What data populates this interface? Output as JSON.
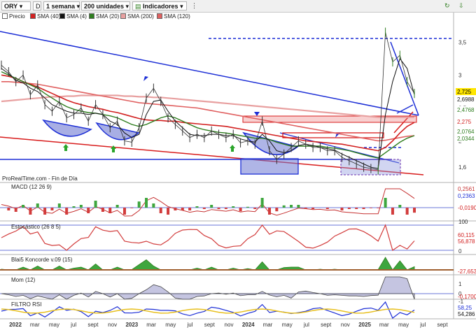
{
  "toolbar": {
    "ticker": "ORY",
    "period_btn": "D",
    "timeframe": "1 semana",
    "units": "200 unidades",
    "indicators": "Indicadores"
  },
  "legend": [
    {
      "label": "Precio",
      "color": "#ffffff"
    },
    {
      "label": "SMA (40)",
      "color": "#d22020"
    },
    {
      "label": "SMA (4)",
      "color": "#111111"
    },
    {
      "label": "SMA (20)",
      "color": "#2e7d1e"
    },
    {
      "label": "SMA (200)",
      "color": "#e8a0a0"
    },
    {
      "label": "SMA (120)",
      "color": "#e06060"
    }
  ],
  "footer_note": "ProRealTime.com - Fin de Día",
  "price_axis": {
    "ticks": [
      "3,5",
      "3",
      "2,5",
      "2",
      "1,6"
    ],
    "last_values": [
      {
        "text": "2,725",
        "color": "#000000",
        "bg": "#ffe600"
      },
      {
        "text": "2,6988",
        "color": "#111111",
        "bg": "#ffffff"
      },
      {
        "text": "2,4768",
        "color": "#2e7d1e",
        "bg": "#ffffff"
      },
      {
        "text": "2,275",
        "color": "#d22020",
        "bg": "#ffffff"
      },
      {
        "text": "2,0764",
        "color": "#2e7d1e",
        "bg": "#ffffff"
      },
      {
        "text": "2,0344",
        "color": "#2e7d1e",
        "bg": "#ffffff"
      }
    ]
  },
  "panels": {
    "macd": {
      "title": "MACD (12 26 9)",
      "values": [
        "0,2561",
        "0,2363",
        "-0,0190"
      ]
    },
    "stoch": {
      "title": "Estocástico (26 8 5)",
      "ticks": [
        "100",
        "0"
      ],
      "values": [
        "60,115",
        "56,878"
      ]
    },
    "koncorde": {
      "title": "Blai5 Koncorde v.09 (15)",
      "values": [
        "-27,653"
      ]
    },
    "mom": {
      "title": "Mom (12)",
      "ticks": [
        "1",
        "0",
        "-1"
      ],
      "values": [
        "-0,1700"
      ]
    },
    "rsi": {
      "title": "FILTRO RSI",
      "values": [
        "58,25",
        "54,286"
      ]
    }
  },
  "time_axis": [
    "2022",
    "mar",
    "may",
    "jul",
    "sept",
    "nov",
    "2023",
    "mar",
    "may",
    "jul",
    "sept",
    "nov",
    "2024",
    "mar",
    "may",
    "jul",
    "sept",
    "nov",
    "2025",
    "mar",
    "may",
    "jul",
    "sept"
  ],
  "chart_data": {
    "type": "line",
    "title": "ORY",
    "xlabel": "",
    "ylabel": "",
    "x_ticks": [
      "2022",
      "mar",
      "may",
      "jul",
      "sept",
      "nov",
      "2023",
      "mar",
      "may",
      "jul",
      "sept",
      "nov",
      "2024",
      "mar",
      "may",
      "jul",
      "sept",
      "nov",
      "2025",
      "mar",
      "may",
      "jul",
      "sept"
    ],
    "y_ticks": [
      3.5,
      3,
      2.5,
      2,
      1.6
    ],
    "ylim": [
      1.4,
      3.8
    ],
    "series": [
      {
        "name": "Precio",
        "values": [
          3.15,
          3.05,
          2.9,
          3.0,
          2.7,
          2.85,
          2.55,
          2.45,
          2.6,
          2.35,
          2.4,
          2.5,
          2.3,
          2.55,
          2.4,
          2.2,
          2.3,
          2.0,
          1.98,
          2.2,
          2.65,
          2.8,
          2.6,
          2.35,
          2.25,
          2.15,
          2.05,
          2.1,
          2.05,
          2.15,
          2.1,
          2.05,
          2.1,
          1.97,
          2.0,
          1.95,
          2.3,
          1.85,
          1.72,
          1.8,
          1.9,
          2.0,
          1.95,
          1.9,
          1.9,
          1.85,
          1.85,
          1.75,
          1.7,
          1.65,
          1.6,
          1.58,
          1.56,
          3.65,
          3.2,
          3.3,
          2.9,
          2.72
        ]
      },
      {
        "name": "SMA (4)",
        "values": [
          3.1,
          3.02,
          2.92,
          2.88,
          2.8,
          2.75,
          2.65,
          2.55,
          2.5,
          2.45,
          2.42,
          2.42,
          2.4,
          2.42,
          2.4,
          2.3,
          2.25,
          2.12,
          2.05,
          2.1,
          2.4,
          2.6,
          2.62,
          2.45,
          2.3,
          2.2,
          2.1,
          2.08,
          2.08,
          2.1,
          2.1,
          2.08,
          2.08,
          2.03,
          2.0,
          1.98,
          2.1,
          2.0,
          1.85,
          1.82,
          1.85,
          1.93,
          1.95,
          1.93,
          1.9,
          1.88,
          1.86,
          1.8,
          1.75,
          1.7,
          1.65,
          1.6,
          1.58,
          2.4,
          2.9,
          3.25,
          3.1,
          2.7
        ]
      },
      {
        "name": "SMA (20)",
        "values": [
          3.05,
          3.0,
          2.95,
          2.9,
          2.85,
          2.8,
          2.72,
          2.65,
          2.58,
          2.52,
          2.48,
          2.45,
          2.43,
          2.42,
          2.4,
          2.38,
          2.35,
          2.3,
          2.25,
          2.22,
          2.25,
          2.3,
          2.35,
          2.38,
          2.35,
          2.3,
          2.25,
          2.2,
          2.17,
          2.15,
          2.13,
          2.12,
          2.1,
          2.08,
          2.06,
          2.04,
          2.04,
          2.02,
          1.98,
          1.95,
          1.92,
          1.92,
          1.92,
          1.92,
          1.92,
          1.9,
          1.89,
          1.87,
          1.85,
          1.82,
          1.79,
          1.76,
          1.74,
          1.82,
          1.9,
          1.98,
          2.04,
          2.08
        ]
      },
      {
        "name": "SMA (40)",
        "values": [
          3.0,
          2.98,
          2.95,
          2.9,
          2.86,
          2.82,
          2.77,
          2.72,
          2.67,
          2.62,
          2.58,
          2.55,
          2.52,
          2.5,
          2.48,
          2.45,
          2.43,
          2.4,
          2.37,
          2.34,
          2.32,
          2.31,
          2.31,
          2.3,
          2.3,
          2.28,
          2.27,
          2.26,
          2.25,
          2.24,
          2.23,
          2.22,
          2.2,
          2.18,
          2.16,
          2.14,
          2.12,
          2.1,
          2.08,
          2.06,
          2.04,
          2.02,
          2.0,
          1.99,
          1.98,
          1.97,
          1.96,
          1.95,
          1.93,
          1.91,
          1.89,
          1.87,
          1.85,
          1.9,
          2.0,
          2.12,
          2.22,
          2.28
        ]
      },
      {
        "name": "SMA (120)",
        "values": [
          2.9,
          2.9,
          2.89,
          2.88,
          2.87,
          2.86,
          2.84,
          2.82,
          2.8,
          2.78,
          2.76,
          2.74,
          2.72,
          2.7,
          2.68,
          2.66,
          2.64,
          2.62,
          2.6,
          2.58,
          2.57,
          2.56,
          2.55,
          2.54,
          2.53,
          2.52,
          2.51,
          2.5,
          2.48,
          2.46,
          2.44,
          2.42,
          2.4,
          2.38,
          2.36,
          2.34,
          2.32,
          2.3,
          2.28,
          2.26,
          2.24,
          2.22,
          2.2,
          2.18,
          2.16,
          2.14,
          2.12,
          2.1,
          2.08,
          2.06,
          2.04,
          2.02,
          2.0,
          2.01,
          2.03,
          2.05,
          2.07,
          2.08
        ]
      },
      {
        "name": "SMA (200)",
        "values": [
          2.6,
          2.61,
          2.62,
          2.63,
          2.64,
          2.65,
          2.66,
          2.67,
          2.67,
          2.68,
          2.68,
          2.69,
          2.69,
          2.69,
          2.69,
          2.69,
          2.69,
          2.68,
          2.68,
          2.67,
          2.67,
          2.66,
          2.66,
          2.65,
          2.64,
          2.63,
          2.62,
          2.61,
          2.6,
          2.59,
          2.58,
          2.57,
          2.56,
          2.55,
          2.54,
          2.53,
          2.52,
          2.51,
          2.5,
          2.49,
          2.48,
          2.47,
          2.46,
          2.45,
          2.44,
          2.43,
          2.42,
          2.41,
          2.4,
          2.39,
          2.38,
          2.37,
          2.36,
          2.36,
          2.36,
          2.36,
          2.36,
          2.36
        ]
      }
    ],
    "grid": false,
    "legend": "top-left"
  }
}
